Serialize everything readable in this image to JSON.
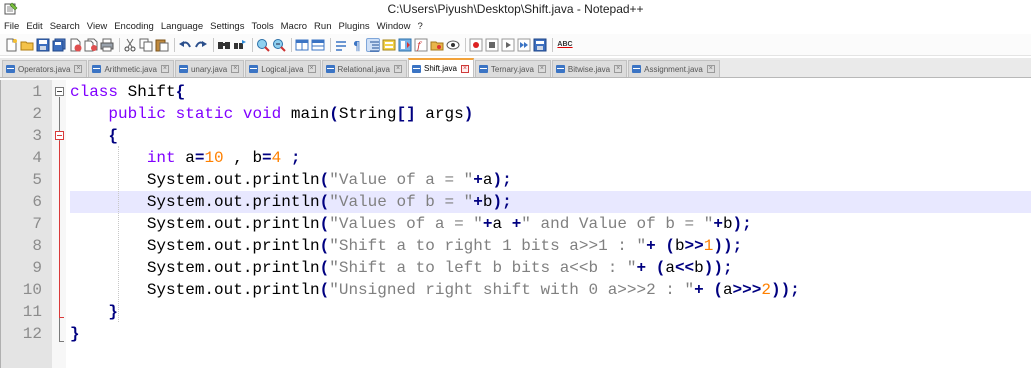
{
  "window": {
    "title": "C:\\Users\\Piyush\\Desktop\\Shift.java - Notepad++"
  },
  "menu": [
    "File",
    "Edit",
    "Search",
    "View",
    "Encoding",
    "Language",
    "Settings",
    "Tools",
    "Macro",
    "Run",
    "Plugins",
    "Window",
    "?"
  ],
  "toolbar": {
    "spellcheck_label": "ABC"
  },
  "tabs": [
    {
      "label": "Operators.java",
      "active": false
    },
    {
      "label": "Arithmetic.java",
      "active": false
    },
    {
      "label": "unary.java",
      "active": false
    },
    {
      "label": "Logical.java",
      "active": false
    },
    {
      "label": "Relational.java",
      "active": false
    },
    {
      "label": "Shift.java",
      "active": true
    },
    {
      "label": "Ternary.java",
      "active": false
    },
    {
      "label": "Bitwise.java",
      "active": false
    },
    {
      "label": "Assignment.java",
      "active": false
    }
  ],
  "editor": {
    "current_line": 6,
    "line_numbers": [
      "1",
      "2",
      "3",
      "4",
      "5",
      "6",
      "7",
      "8",
      "9",
      "10",
      "11",
      "12"
    ],
    "lines": [
      [
        {
          "t": "class",
          "c": "kw"
        },
        {
          "t": " Shift",
          "c": "id"
        },
        {
          "t": "{",
          "c": "br"
        }
      ],
      [
        {
          "t": "    ",
          "c": "id"
        },
        {
          "t": "public",
          "c": "kw"
        },
        {
          "t": " ",
          "c": "id"
        },
        {
          "t": "static",
          "c": "kw"
        },
        {
          "t": " ",
          "c": "id"
        },
        {
          "t": "void",
          "c": "type"
        },
        {
          "t": " main",
          "c": "id"
        },
        {
          "t": "(",
          "c": "br"
        },
        {
          "t": "String",
          "c": "id"
        },
        {
          "t": "[]",
          "c": "br"
        },
        {
          "t": " args",
          "c": "id"
        },
        {
          "t": ")",
          "c": "br"
        }
      ],
      [
        {
          "t": "    ",
          "c": "id"
        },
        {
          "t": "{",
          "c": "br"
        }
      ],
      [
        {
          "t": "        ",
          "c": "id"
        },
        {
          "t": "int",
          "c": "type"
        },
        {
          "t": " a",
          "c": "id"
        },
        {
          "t": "=",
          "c": "op"
        },
        {
          "t": "10",
          "c": "num"
        },
        {
          "t": " , b",
          "c": "id"
        },
        {
          "t": "=",
          "c": "op"
        },
        {
          "t": "4",
          "c": "num"
        },
        {
          "t": " ;",
          "c": "op"
        }
      ],
      [
        {
          "t": "        ",
          "c": "id"
        },
        {
          "t": "System.out.println",
          "c": "id"
        },
        {
          "t": "(",
          "c": "br"
        },
        {
          "t": "\"Value of a = \"",
          "c": "str"
        },
        {
          "t": "+",
          "c": "op"
        },
        {
          "t": "a",
          "c": "id"
        },
        {
          "t": ");",
          "c": "br"
        }
      ],
      [
        {
          "t": "        ",
          "c": "id"
        },
        {
          "t": "System.out.println",
          "c": "id"
        },
        {
          "t": "(",
          "c": "br"
        },
        {
          "t": "\"Value of b = \"",
          "c": "str"
        },
        {
          "t": "+",
          "c": "op"
        },
        {
          "t": "b",
          "c": "id"
        },
        {
          "t": ");",
          "c": "br"
        }
      ],
      [
        {
          "t": "        ",
          "c": "id"
        },
        {
          "t": "System.out.println",
          "c": "id"
        },
        {
          "t": "(",
          "c": "br"
        },
        {
          "t": "\"Values of a = \"",
          "c": "str"
        },
        {
          "t": "+",
          "c": "op"
        },
        {
          "t": "a ",
          "c": "id"
        },
        {
          "t": "+",
          "c": "op"
        },
        {
          "t": "\" and Value of b = \"",
          "c": "str"
        },
        {
          "t": "+",
          "c": "op"
        },
        {
          "t": "b",
          "c": "id"
        },
        {
          "t": ");",
          "c": "br"
        }
      ],
      [
        {
          "t": "        ",
          "c": "id"
        },
        {
          "t": "System.out.println",
          "c": "id"
        },
        {
          "t": "(",
          "c": "br"
        },
        {
          "t": "\"Shift a to right 1 bits a>>1 : \"",
          "c": "str"
        },
        {
          "t": "+",
          "c": "op"
        },
        {
          "t": " ",
          "c": "id"
        },
        {
          "t": "(",
          "c": "br"
        },
        {
          "t": "b",
          "c": "id"
        },
        {
          "t": ">>",
          "c": "op"
        },
        {
          "t": "1",
          "c": "num"
        },
        {
          "t": "));",
          "c": "br"
        }
      ],
      [
        {
          "t": "        ",
          "c": "id"
        },
        {
          "t": "System.out.println",
          "c": "id"
        },
        {
          "t": "(",
          "c": "br"
        },
        {
          "t": "\"Shift a to left b bits a<<b : \"",
          "c": "str"
        },
        {
          "t": "+",
          "c": "op"
        },
        {
          "t": " ",
          "c": "id"
        },
        {
          "t": "(",
          "c": "br"
        },
        {
          "t": "a",
          "c": "id"
        },
        {
          "t": "<<",
          "c": "op"
        },
        {
          "t": "b",
          "c": "id"
        },
        {
          "t": "));",
          "c": "br"
        }
      ],
      [
        {
          "t": "        ",
          "c": "id"
        },
        {
          "t": "System.out.println",
          "c": "id"
        },
        {
          "t": "(",
          "c": "br"
        },
        {
          "t": "\"Unsigned right shift with 0 a>>>2 : \"",
          "c": "str"
        },
        {
          "t": "+",
          "c": "op"
        },
        {
          "t": " ",
          "c": "id"
        },
        {
          "t": "(",
          "c": "br"
        },
        {
          "t": "a",
          "c": "id"
        },
        {
          "t": ">>>",
          "c": "op"
        },
        {
          "t": "2",
          "c": "num"
        },
        {
          "t": "));",
          "c": "br"
        }
      ],
      [
        {
          "t": "    ",
          "c": "id"
        },
        {
          "t": "}",
          "c": "br"
        }
      ],
      [
        {
          "t": "}",
          "c": "br"
        }
      ]
    ]
  },
  "colors": {
    "keyword": "#8000ff",
    "number": "#ff8000",
    "string": "#808080",
    "operator": "#000080",
    "current_line_bg": "#e8e8ff",
    "gutter_bg": "#e4e4e4",
    "fold_marker_active": "#d93a3a"
  },
  "icons": [
    "notepad-app-icon",
    "new-file-icon",
    "open-file-icon",
    "save-icon",
    "save-all-icon",
    "close-icon",
    "close-all-icon",
    "print-icon",
    "cut-icon",
    "copy-icon",
    "paste-icon",
    "undo-icon",
    "redo-icon",
    "find-icon",
    "replace-icon",
    "zoom-in-icon",
    "zoom-out-icon",
    "sync-vertical-icon",
    "sync-horizontal-icon",
    "word-wrap-icon",
    "show-all-chars-icon",
    "indent-guide-icon",
    "udl-icon",
    "doc-map-icon",
    "function-list-icon",
    "folder-workspace-icon",
    "monitoring-icon",
    "record-macro-icon",
    "stop-record-icon",
    "play-macro-icon",
    "run-multiple-icon",
    "save-macro-icon",
    "spell-check-icon"
  ]
}
